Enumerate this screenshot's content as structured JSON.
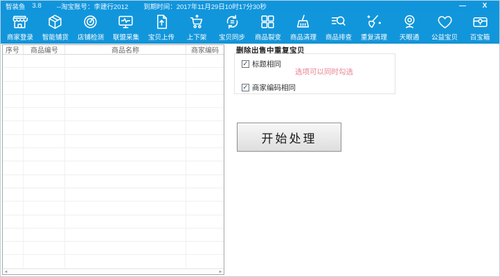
{
  "window": {
    "app_name": "智装鱼",
    "version": "3.8",
    "account_info": "--淘宝账号：李建行2012",
    "expiry_info": "到期时间：2017年11月29日10时17分30秒",
    "minimize_label": "—",
    "close_label": "X"
  },
  "colors": {
    "titlebar_blue": "#1095dc",
    "toolbar_blue": "#1296db",
    "hint_pink": "#e8808e"
  },
  "toolbar": {
    "items": [
      {
        "label": "商家登录",
        "icon": "storefront-icon"
      },
      {
        "label": "智能铺货",
        "icon": "package-icon"
      },
      {
        "label": "店铺检测",
        "icon": "radar-icon"
      },
      {
        "label": "联盟采集",
        "icon": "monitor-wave-icon"
      },
      {
        "label": "宝贝上传",
        "icon": "upload-doc-icon"
      },
      {
        "label": "上下架",
        "icon": "cart-icon"
      },
      {
        "label": "宝贝同步",
        "icon": "sync-icon"
      },
      {
        "label": "商品裂变",
        "icon": "grid-icon"
      },
      {
        "label": "商品清理",
        "icon": "broom-icon"
      },
      {
        "label": "商品排查",
        "icon": "search-list-icon"
      },
      {
        "label": "重复清理",
        "icon": "broom-sparkle-icon"
      },
      {
        "label": "天眼通",
        "icon": "webcam-icon"
      },
      {
        "label": "公益宝贝",
        "icon": "heart-icon"
      },
      {
        "label": "百宝箱",
        "icon": "treasure-box-icon"
      }
    ]
  },
  "table": {
    "headers": [
      "序号",
      "商品编号",
      "商品名称",
      "商家编码"
    ],
    "rows": []
  },
  "panel": {
    "title": "删除出售中重复宝贝",
    "checkboxes": [
      {
        "label": "标题相同",
        "checked": true
      },
      {
        "label": "商家编码相同",
        "checked": true
      }
    ],
    "hint": "选项可以同时勾选",
    "start_button_label": "开始处理"
  }
}
